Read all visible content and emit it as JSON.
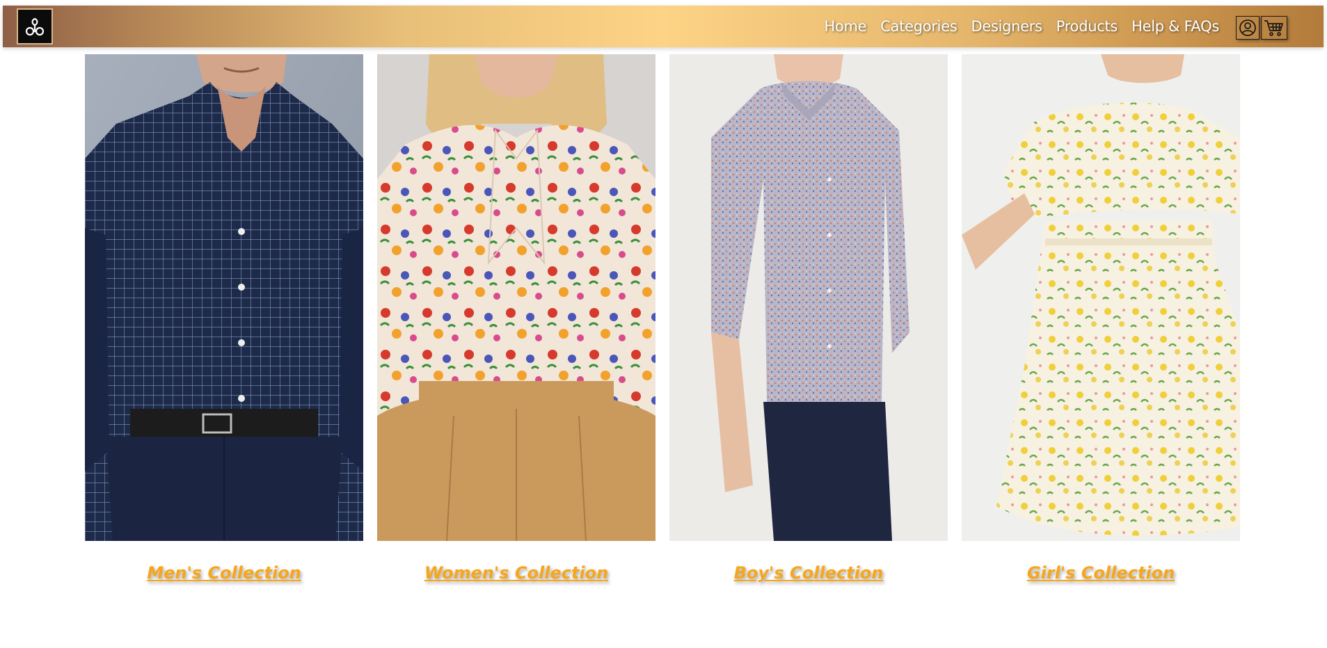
{
  "header": {
    "logo_icon": "swirl-logo-icon",
    "nav": [
      {
        "label": "Home"
      },
      {
        "label": "Categories"
      },
      {
        "label": "Designers"
      },
      {
        "label": "Products"
      },
      {
        "label": "Help & FAQs"
      }
    ],
    "user_icon": "user-icon",
    "cart_icon": "cart-icon"
  },
  "collections": [
    {
      "label": "Men's Collection",
      "image": "man-navy-check-shirt-photo"
    },
    {
      "label": "Women's Collection",
      "image": "woman-floral-blouse-photo"
    },
    {
      "label": "Boy's Collection",
      "image": "boy-floral-shirt-photo"
    },
    {
      "label": "Girl's Collection",
      "image": "girl-floral-dress-photo"
    }
  ],
  "colors": {
    "caption": "#f7a61b",
    "nav_gradient_start": "#8e5f46",
    "nav_gradient_mid": "#fdd386",
    "nav_gradient_end": "#b37b3b"
  }
}
